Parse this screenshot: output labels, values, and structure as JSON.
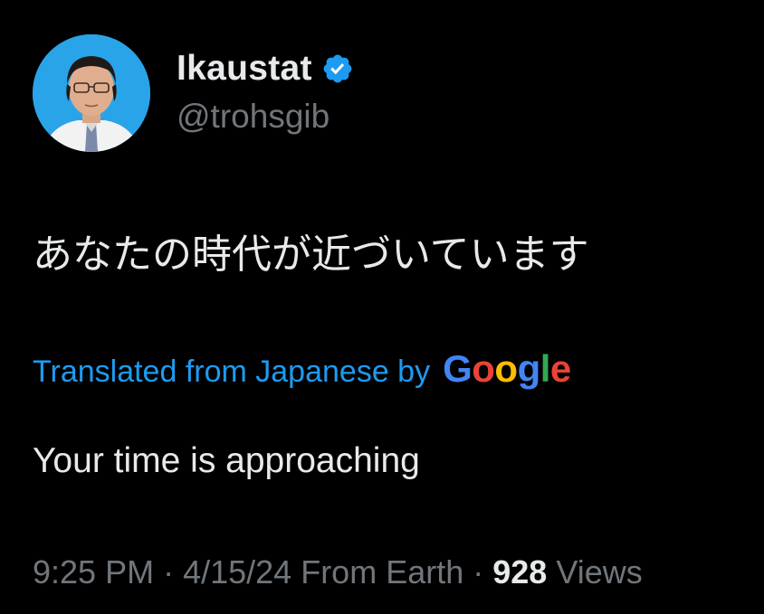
{
  "author": {
    "name": "Ikaustat",
    "handle": "@trohsgib",
    "verified_icon": "verified-badge-icon",
    "avatar_bg_color": "#2aa4e8"
  },
  "post": {
    "original_text": "あなたの時代が近づいています",
    "translation_label": "Translated from Japanese by",
    "translation_provider": {
      "letters": [
        "G",
        "o",
        "o",
        "g",
        "l",
        "e"
      ],
      "colors": [
        "#4285F4",
        "#EA4335",
        "#FBBC05",
        "#4285F4",
        "#34A853",
        "#EA4335"
      ]
    },
    "translated_text": "Your time is approaching"
  },
  "meta": {
    "time": "9:25 PM",
    "separator1": " · ",
    "date": "4/15/24",
    "location": " From Earth",
    "separator2": " · ",
    "views_count": "928",
    "views_label": " Views"
  },
  "colors": {
    "background": "#000000",
    "primary_text": "#e7e9ea",
    "secondary_text": "#71767b",
    "link": "#1d9bf0",
    "verified": "#1d9bf0"
  }
}
